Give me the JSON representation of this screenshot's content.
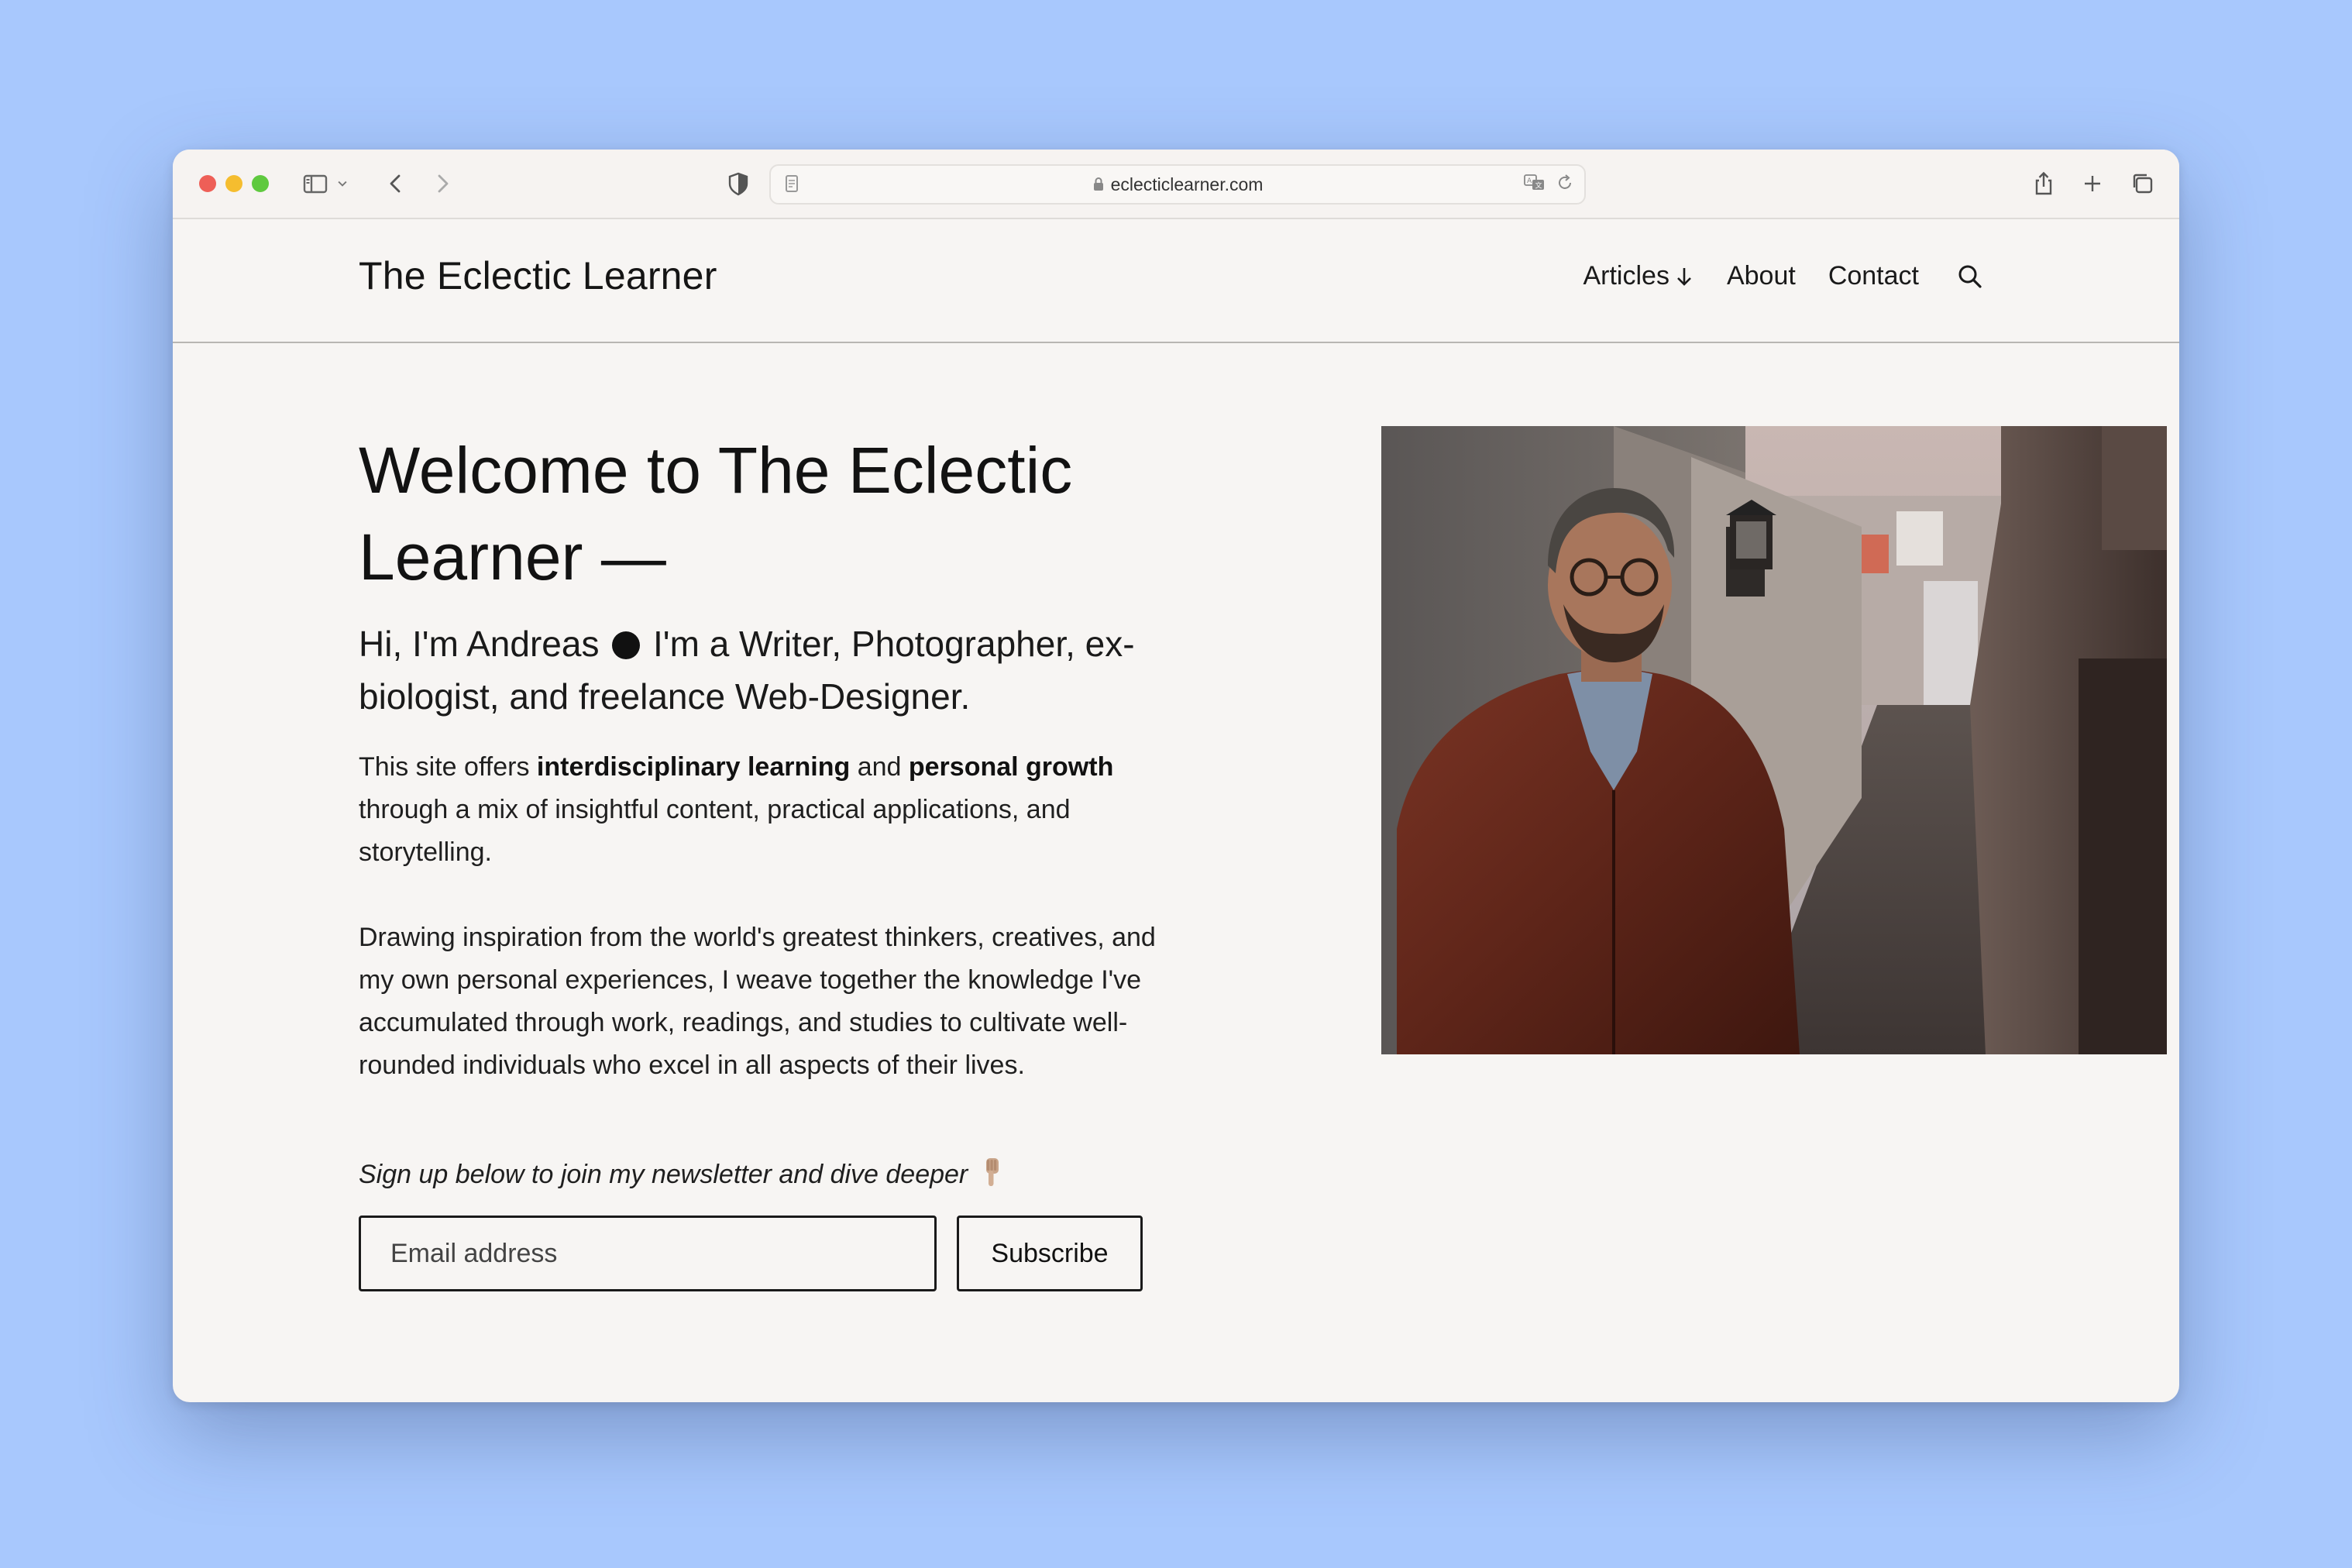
{
  "browser": {
    "url": "eclecticlearner.com"
  },
  "site": {
    "title": "The Eclectic Learner",
    "nav": {
      "articles": "Articles",
      "about": "About",
      "contact": "Contact"
    }
  },
  "hero": {
    "title": "Welcome to The Eclectic Learner —",
    "intro_before": "Hi, I'm Andreas",
    "intro_after": "I'm a Writer, Photographer, ex-biologist, and freelance Web-Designer.",
    "p1": {
      "t1": "This site offers ",
      "b1": "interdisciplinary learning",
      "t2": " and ",
      "b2": "personal growth",
      "t3": " through a mix of insightful content, practical applications, and storytelling."
    },
    "p2": "Drawing inspiration from the world's greatest thinkers, creatives, and my own personal experiences, I weave together the knowledge I've accumulated through work, readings, and studies to cultivate well-rounded individuals who excel in all aspects of their lives.",
    "signup_note": "Sign up below to join my newsletter and dive deeper"
  },
  "newsletter": {
    "email_placeholder": "Email address",
    "subscribe_label": "Subscribe"
  },
  "icons": {
    "toolbar": [
      "sidebar-icon",
      "chevron-down-icon",
      "back-icon",
      "forward-icon",
      "shield-icon",
      "share-icon",
      "plus-icon",
      "tabs-icon"
    ],
    "address_bar": [
      "reader-icon",
      "lock-icon",
      "translate-icon",
      "reload-icon"
    ],
    "nav": [
      "arrow-down-icon",
      "search-icon"
    ]
  },
  "colors": {
    "desktop_background": "#a8c8fd",
    "page_background": "#f7f5f3",
    "text": "#121212"
  }
}
